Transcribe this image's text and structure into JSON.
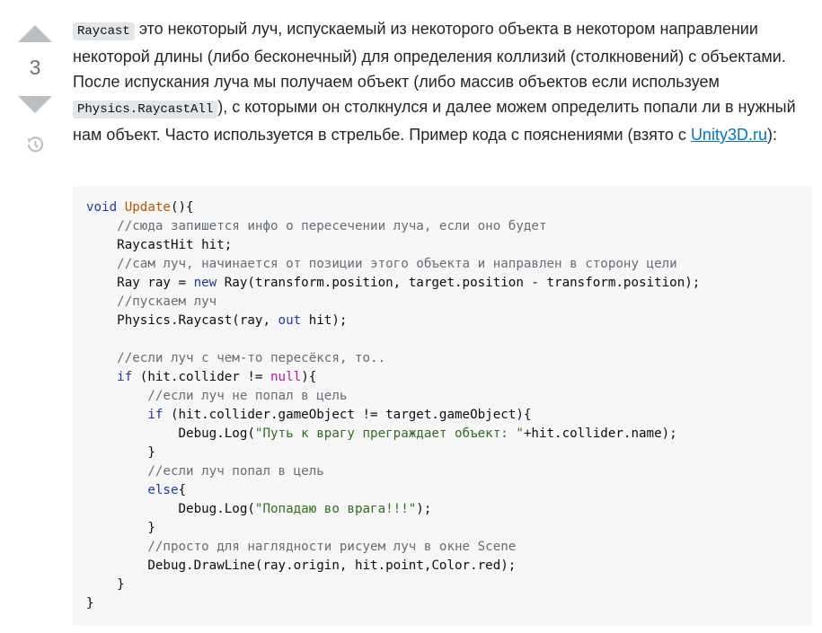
{
  "vote": {
    "score": "3"
  },
  "post": {
    "inline_raycast": "Raycast",
    "text1": " это некоторый луч, испускаемый из некоторого объекта в некотором направлении некоторой длины (либо бесконечный) для определения коллизий (столкновений) с объектами. После испускания луча мы получаем объект (либо массив объектов если используем ",
    "inline_raycastall": "Physics.RaycastAll",
    "text2": "), с которыми он столкнулся и далее можем определить попали ли в нужный нам объект. Часто используется в стрельбе. Пример кода с пояснениями (взято с ",
    "link_text": "Unity3D.ru",
    "text3": "):"
  },
  "code": {
    "l01a": "void",
    "l01b": " ",
    "l01c": "Update",
    "l01d": "(){",
    "l02": "    //сюда запишется инфо о пересечении луча, если оно будет",
    "l03": "    RaycastHit hit;",
    "l04": "    //сам луч, начинается от позиции этого объекта и направлен в сторону цели",
    "l05a": "    Ray ray = ",
    "l05b": "new",
    "l05c": " Ray(transform.position, target.position - transform.position);",
    "l06": "    //пускаем луч",
    "l07a": "    Physics.Raycast(ray, ",
    "l07b": "out",
    "l07c": " hit);",
    "l08": "",
    "l09": "    //если луч с чем-то пересёкся, то..",
    "l10a": "    ",
    "l10b": "if",
    "l10c": " (hit.collider != ",
    "l10d": "null",
    "l10e": "){",
    "l11": "        //если луч не попал в цель",
    "l12a": "        ",
    "l12b": "if",
    "l12c": " (hit.collider.gameObject != target.gameObject){",
    "l13a": "            Debug.Log(",
    "l13b": "\"Путь к врагу преграждает объект: \"",
    "l13c": "+hit.collider.name);",
    "l14": "        }",
    "l15": "        //если луч попал в цель",
    "l16a": "        ",
    "l16b": "else",
    "l16c": "{",
    "l17a": "            Debug.Log(",
    "l17b": "\"Попадаю во врага!!!\"",
    "l17c": ");",
    "l18": "        }",
    "l19": "        //просто для наглядности рисуем луч в окне Scene",
    "l20": "        Debug.DrawLine(ray.origin, hit.point,Color.red);",
    "l21": "    }",
    "l22": "}"
  }
}
